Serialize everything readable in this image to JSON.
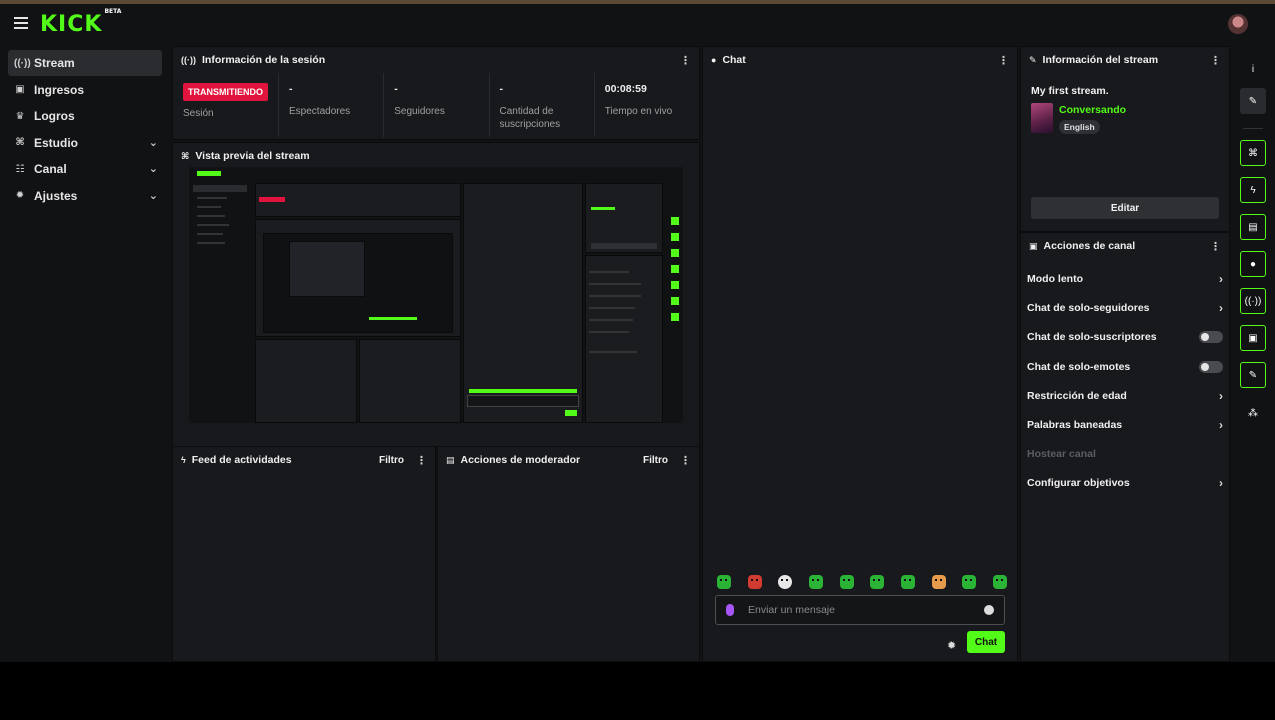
{
  "brand": {
    "logo": "KICK",
    "badge": "BETA"
  },
  "sidebar": {
    "items": [
      {
        "label": "Stream",
        "icon": "broadcast-icon",
        "glyph": "((·))",
        "active": true,
        "expandable": false
      },
      {
        "label": "Ingresos",
        "icon": "revenue-icon",
        "glyph": "▣",
        "active": false,
        "expandable": false
      },
      {
        "label": "Logros",
        "icon": "trophy-icon",
        "glyph": "♛",
        "active": false,
        "expandable": false
      },
      {
        "label": "Estudio",
        "icon": "studio-icon",
        "glyph": "⌘",
        "active": false,
        "expandable": true
      },
      {
        "label": "Canal",
        "icon": "channel-icon",
        "glyph": "☷",
        "active": false,
        "expandable": true
      },
      {
        "label": "Ajustes",
        "icon": "settings-icon",
        "glyph": "✹",
        "active": false,
        "expandable": true
      }
    ]
  },
  "session": {
    "title": "Información de la sesión",
    "badge": "TRANSMITIENDO",
    "badge_label": "Sesión",
    "stats": [
      {
        "value": "-",
        "label": "Espectadores"
      },
      {
        "value": "-",
        "label": "Seguidores"
      },
      {
        "value": "-",
        "label": "Cantidad de suscripciones"
      },
      {
        "value": "00:08:59",
        "label": "Tiempo en vivo"
      }
    ]
  },
  "preview": {
    "title": "Vista previa del stream"
  },
  "activity": {
    "title": "Feed de actividades",
    "filter": "Filtro"
  },
  "moderator": {
    "title": "Acciones de moderador",
    "filter": "Filtro"
  },
  "chat": {
    "title": "Chat",
    "placeholder": "Enviar un mensaje",
    "send_label": "Chat",
    "emotes": [
      "green",
      "red",
      "white",
      "green",
      "green",
      "green",
      "green",
      "orange",
      "green",
      "green"
    ]
  },
  "stream_info": {
    "title": "Información del stream",
    "stream_title": "My first stream.",
    "category": "Conversando",
    "language": "English",
    "edit_label": "Editar"
  },
  "channel_actions": {
    "title": "Acciones de canal",
    "items": [
      {
        "label": "Modo lento",
        "control": "arrow",
        "disabled": false
      },
      {
        "label": "Chat de solo-seguidores",
        "control": "arrow",
        "disabled": false
      },
      {
        "label": "Chat de solo-suscriptores",
        "control": "toggle",
        "disabled": false,
        "on": false
      },
      {
        "label": "Chat de solo-emotes",
        "control": "toggle",
        "disabled": false,
        "on": false
      },
      {
        "label": "Restricción de edad",
        "control": "arrow",
        "disabled": false
      },
      {
        "label": "Palabras baneadas",
        "control": "arrow",
        "disabled": false
      },
      {
        "label": "Hostear canal",
        "control": "none",
        "disabled": true
      },
      {
        "label": "Configurar objetivos",
        "control": "arrow",
        "disabled": false
      }
    ]
  },
  "rail": {
    "buttons": [
      {
        "icon": "info-icon",
        "glyph": "i",
        "style": "plain"
      },
      {
        "icon": "pencil-icon",
        "glyph": "✎",
        "style": "dark"
      },
      {
        "icon": "session-icon",
        "glyph": "⌘",
        "style": "green"
      },
      {
        "icon": "lightning-icon",
        "glyph": "ϟ",
        "style": "green"
      },
      {
        "icon": "document-icon",
        "glyph": "▤",
        "style": "green"
      },
      {
        "icon": "chat-bubble-icon",
        "glyph": "●",
        "style": "green"
      },
      {
        "icon": "broadcast-icon",
        "glyph": "((·))",
        "style": "green"
      },
      {
        "icon": "moderator-icon",
        "glyph": "▣",
        "style": "green"
      },
      {
        "icon": "wrench-icon",
        "glyph": "✎",
        "style": "green"
      },
      {
        "icon": "widgets-icon",
        "glyph": "⁂",
        "style": "plain"
      }
    ]
  },
  "colors": {
    "accent": "#53fc18",
    "live": "#e0143c",
    "panel": "#18191c",
    "background": "#111214"
  }
}
